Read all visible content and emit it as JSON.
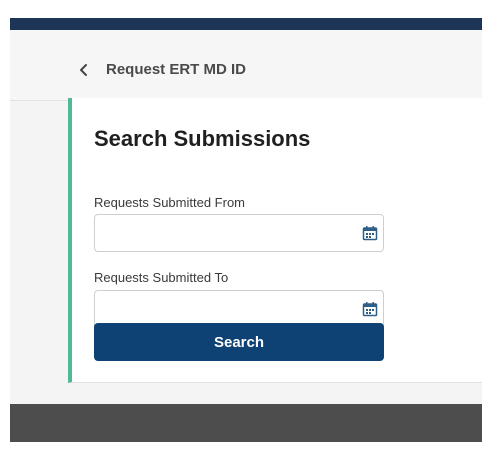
{
  "header": {
    "back_icon": "chevron-left-icon",
    "title": "Request ERT MD ID"
  },
  "search_form": {
    "title": "Search Submissions",
    "from": {
      "label": "Requests Submitted From",
      "value": "",
      "placeholder": "",
      "icon": "calendar-icon"
    },
    "to": {
      "label": "Requests Submitted To",
      "value": "",
      "placeholder": "",
      "icon": "calendar-icon"
    },
    "search_label": "Search"
  },
  "colors": {
    "top_bar": "#1d3557",
    "accent_border": "#4fb99a",
    "primary_button": "#0e4275",
    "footer": "#4d4d4d",
    "calendar_icon": "#2f5e86"
  }
}
